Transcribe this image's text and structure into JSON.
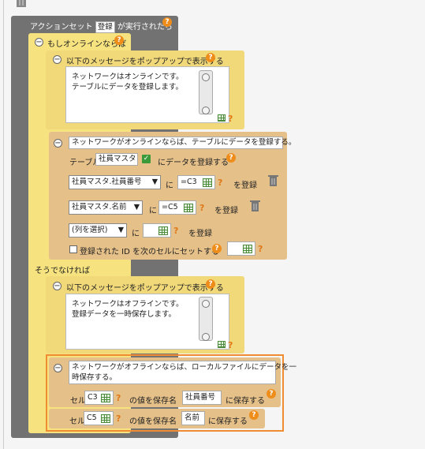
{
  "header": {
    "title_prefix": "アクションセット",
    "action_set_name": "登録",
    "title_suffix": "が実行されたら"
  },
  "if_block": {
    "label": "もしオンラインならば",
    "else_label": "そうでなければ"
  },
  "popup_online": {
    "label": "以下のメッセージをポップアップで表示する",
    "message_line1": "ネットワークはオンラインです。",
    "message_line2": "テーブルにデータを登録します。"
  },
  "register_block": {
    "comment": "ネットワークがオンラインならば、テーブルにデータを登録する。",
    "table_prefix": "テーブル",
    "table_name": "社員マスタ",
    "table_suffix": "にデータを登録する",
    "rows": [
      {
        "column": "社員マスタ.社員番号",
        "ni": "に",
        "value": "=C3",
        "suffix": "を登録"
      },
      {
        "column": "社員マスタ.名前",
        "ni": "に",
        "value": "=C5",
        "suffix": "を登録"
      },
      {
        "column": "(列を選択)",
        "ni": "に",
        "value": "",
        "suffix": "を登録"
      }
    ],
    "id_checkbox_label": "登録された ID を次のセルにセットする"
  },
  "popup_offline": {
    "label": "以下のメッセージをポップアップで表示する",
    "message_line1": "ネットワークはオフラインです。",
    "message_line2": "登録データを一時保存します。"
  },
  "save_block": {
    "comment_line1": "ネットワークがオフラインならば、ローカルファイルにデータを一",
    "comment_line2": "時保存する。",
    "rows": [
      {
        "cell_label": "セル",
        "cell": "C3",
        "middle": "の値を保存名",
        "save_name": "社員番号",
        "suffix": "に保存する"
      },
      {
        "cell_label": "セル",
        "cell": "C5",
        "middle": "の値を保存名",
        "save_name": "名前",
        "suffix": "に保存する"
      }
    ]
  },
  "help_mark": "?",
  "icons": {
    "collapse": "minus-circle-icon",
    "trash": "trash-icon",
    "cell_picker": "spreadsheet-icon",
    "formula": "formula-icon",
    "help": "help-icon",
    "checkbox": "check-icon"
  },
  "colors": {
    "gray_block": "#727272",
    "yellow_block": "#f6e37f",
    "tan_block": "#e5c089",
    "help_orange": "#ef8d1b",
    "highlight_frame": "#f08c32"
  }
}
